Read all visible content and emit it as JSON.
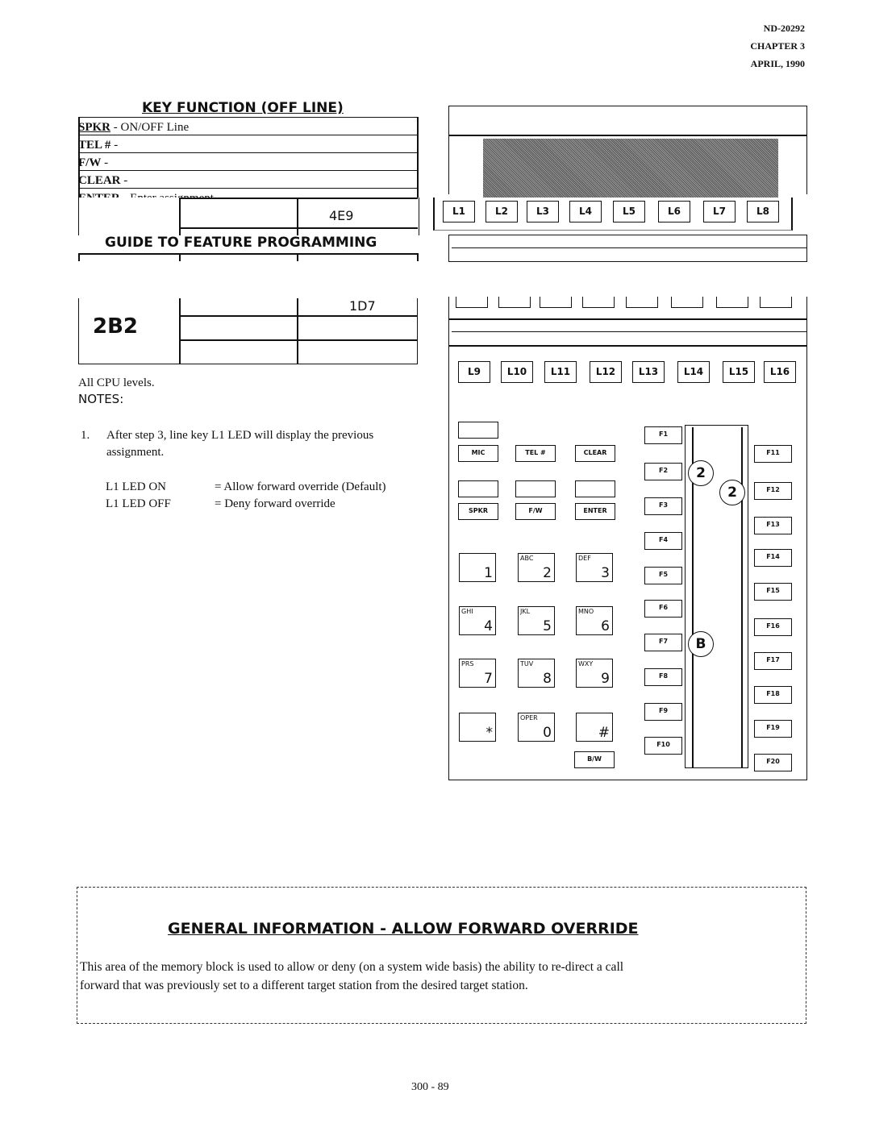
{
  "header": {
    "doc": "ND-20292",
    "chapter": "CHAPTER 3",
    "date": "APRIL, 1990"
  },
  "key_function": {
    "title": "KEY FUNCTION (OFF LINE)",
    "rows": [
      {
        "key": "SPKR",
        "desc": " - ON/OFF Line"
      },
      {
        "key": "TEL #",
        "desc": " -"
      },
      {
        "key": "F/W",
        "desc": " -"
      },
      {
        "key": "CLEAR",
        "desc": " -"
      },
      {
        "key": "ENTER",
        "desc": " - Enter assignment"
      }
    ]
  },
  "address_upper": "4E9",
  "guide_title": "GUIDE TO FEATURE PROGRAMMING",
  "memory_block": {
    "main": "2B2",
    "sub": "1D7"
  },
  "cpu_levels": "All CPU levels.",
  "notes": {
    "title": "NOTES:",
    "items": [
      {
        "num": "1.",
        "text": "After step 3, line key L1 LED  will display the previous assignment."
      }
    ],
    "led": [
      {
        "state": "L1 LED ON",
        "meaning": "= Allow forward override (Default)"
      },
      {
        "state": "L1 LED OFF",
        "meaning": "= Deny forward override"
      }
    ]
  },
  "phone": {
    "line_keys_top": [
      "L1",
      "L2",
      "L3",
      "L4",
      "L5",
      "L6",
      "L7",
      "L8"
    ],
    "line_keys_bottom": [
      "L9",
      "L10",
      "L11",
      "L12",
      "L13",
      "L14",
      "L15",
      "L16"
    ],
    "func_keys_row1": [
      "MIC",
      "TEL #",
      "CLEAR"
    ],
    "func_keys_row2": [
      "SPKR",
      "F/W",
      "ENTER"
    ],
    "dialpad": [
      {
        "n": "1",
        "l": ""
      },
      {
        "n": "2",
        "l": "ABC"
      },
      {
        "n": "3",
        "l": "DEF"
      },
      {
        "n": "4",
        "l": "GHI"
      },
      {
        "n": "5",
        "l": "JKL"
      },
      {
        "n": "6",
        "l": "MNO"
      },
      {
        "n": "7",
        "l": "PRS"
      },
      {
        "n": "8",
        "l": "TUV"
      },
      {
        "n": "9",
        "l": "WXY"
      },
      {
        "n": "*",
        "l": ""
      },
      {
        "n": "0",
        "l": "OPER"
      },
      {
        "n": "#",
        "l": ""
      }
    ],
    "bw": "B/W",
    "f_left": [
      "F1",
      "F2",
      "F3",
      "F4",
      "F5",
      "F6",
      "F7",
      "F8",
      "F9",
      "F10"
    ],
    "f_right": [
      "F11",
      "F12",
      "F13",
      "F14",
      "F15",
      "F16",
      "F17",
      "F18",
      "F19",
      "F20"
    ],
    "step_markers": [
      "2",
      "2",
      "B"
    ]
  },
  "general": {
    "title": "GENERAL INFORMATION - ALLOW FORWARD OVERRIDE",
    "lines": [
      "This area of the memory block is used to allow or deny (on a system wide basis) the ability to re-direct a call",
      "forward that was previously set to a different target station from the desired target station."
    ]
  },
  "page_number": "300 - 89"
}
